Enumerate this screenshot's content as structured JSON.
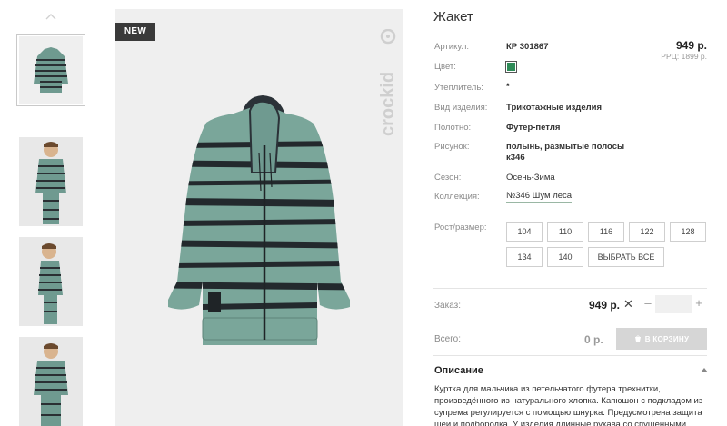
{
  "product": {
    "title": "Жакет",
    "badge": "NEW",
    "brand": "crockid",
    "price": "949 р.",
    "rrc_price": "РРЦ: 1899 р.",
    "swatch_color": "#2e8b57"
  },
  "details": {
    "article": {
      "label": "Артикул:",
      "value": "КР 301867"
    },
    "color": {
      "label": "Цвет:"
    },
    "insulation": {
      "label": "Утеплитель:",
      "value": "*"
    },
    "item_type": {
      "label": "Вид изделия:",
      "value": "Трикотажные изделия"
    },
    "fabric": {
      "label": "Полотно:",
      "value": "Футер-петля"
    },
    "pattern": {
      "label": "Рисунок:",
      "value_line1": "полынь, размытые полосы",
      "value_line2": "к346"
    },
    "season": {
      "label": "Сезон:",
      "value": "Осень-Зима"
    },
    "collection": {
      "label": "Коллекция:",
      "value": "№346 Шум леса"
    }
  },
  "sizes": {
    "label": "Рост/размер:",
    "options": [
      "104",
      "110",
      "116",
      "122",
      "128",
      "134",
      "140"
    ],
    "select_all": "ВЫБРАТЬ ВСЕ"
  },
  "order": {
    "label": "Заказ:",
    "price": "949 р.",
    "times": "✕",
    "minus": "–",
    "plus": "+",
    "quantity": ""
  },
  "total": {
    "label": "Всего:",
    "value": "0 р.",
    "cart_button": "В КОРЗИНУ"
  },
  "description": {
    "heading": "Описание",
    "line1": "Куртка для мальчика из петельчатого футера трехнитки,",
    "line2": "произведённого из натурального хлопка. Капюшон с подкладом из",
    "line3": "супрема регулируется с помощью шнурка. Предусмотрена защита",
    "line4": "шеи и подбородка. У изделия длинные рукава со спущенными"
  },
  "icons": {
    "thumb_up": "chevron-up-icon",
    "cart": "cart-icon",
    "toggle": "chevron-up-icon"
  }
}
